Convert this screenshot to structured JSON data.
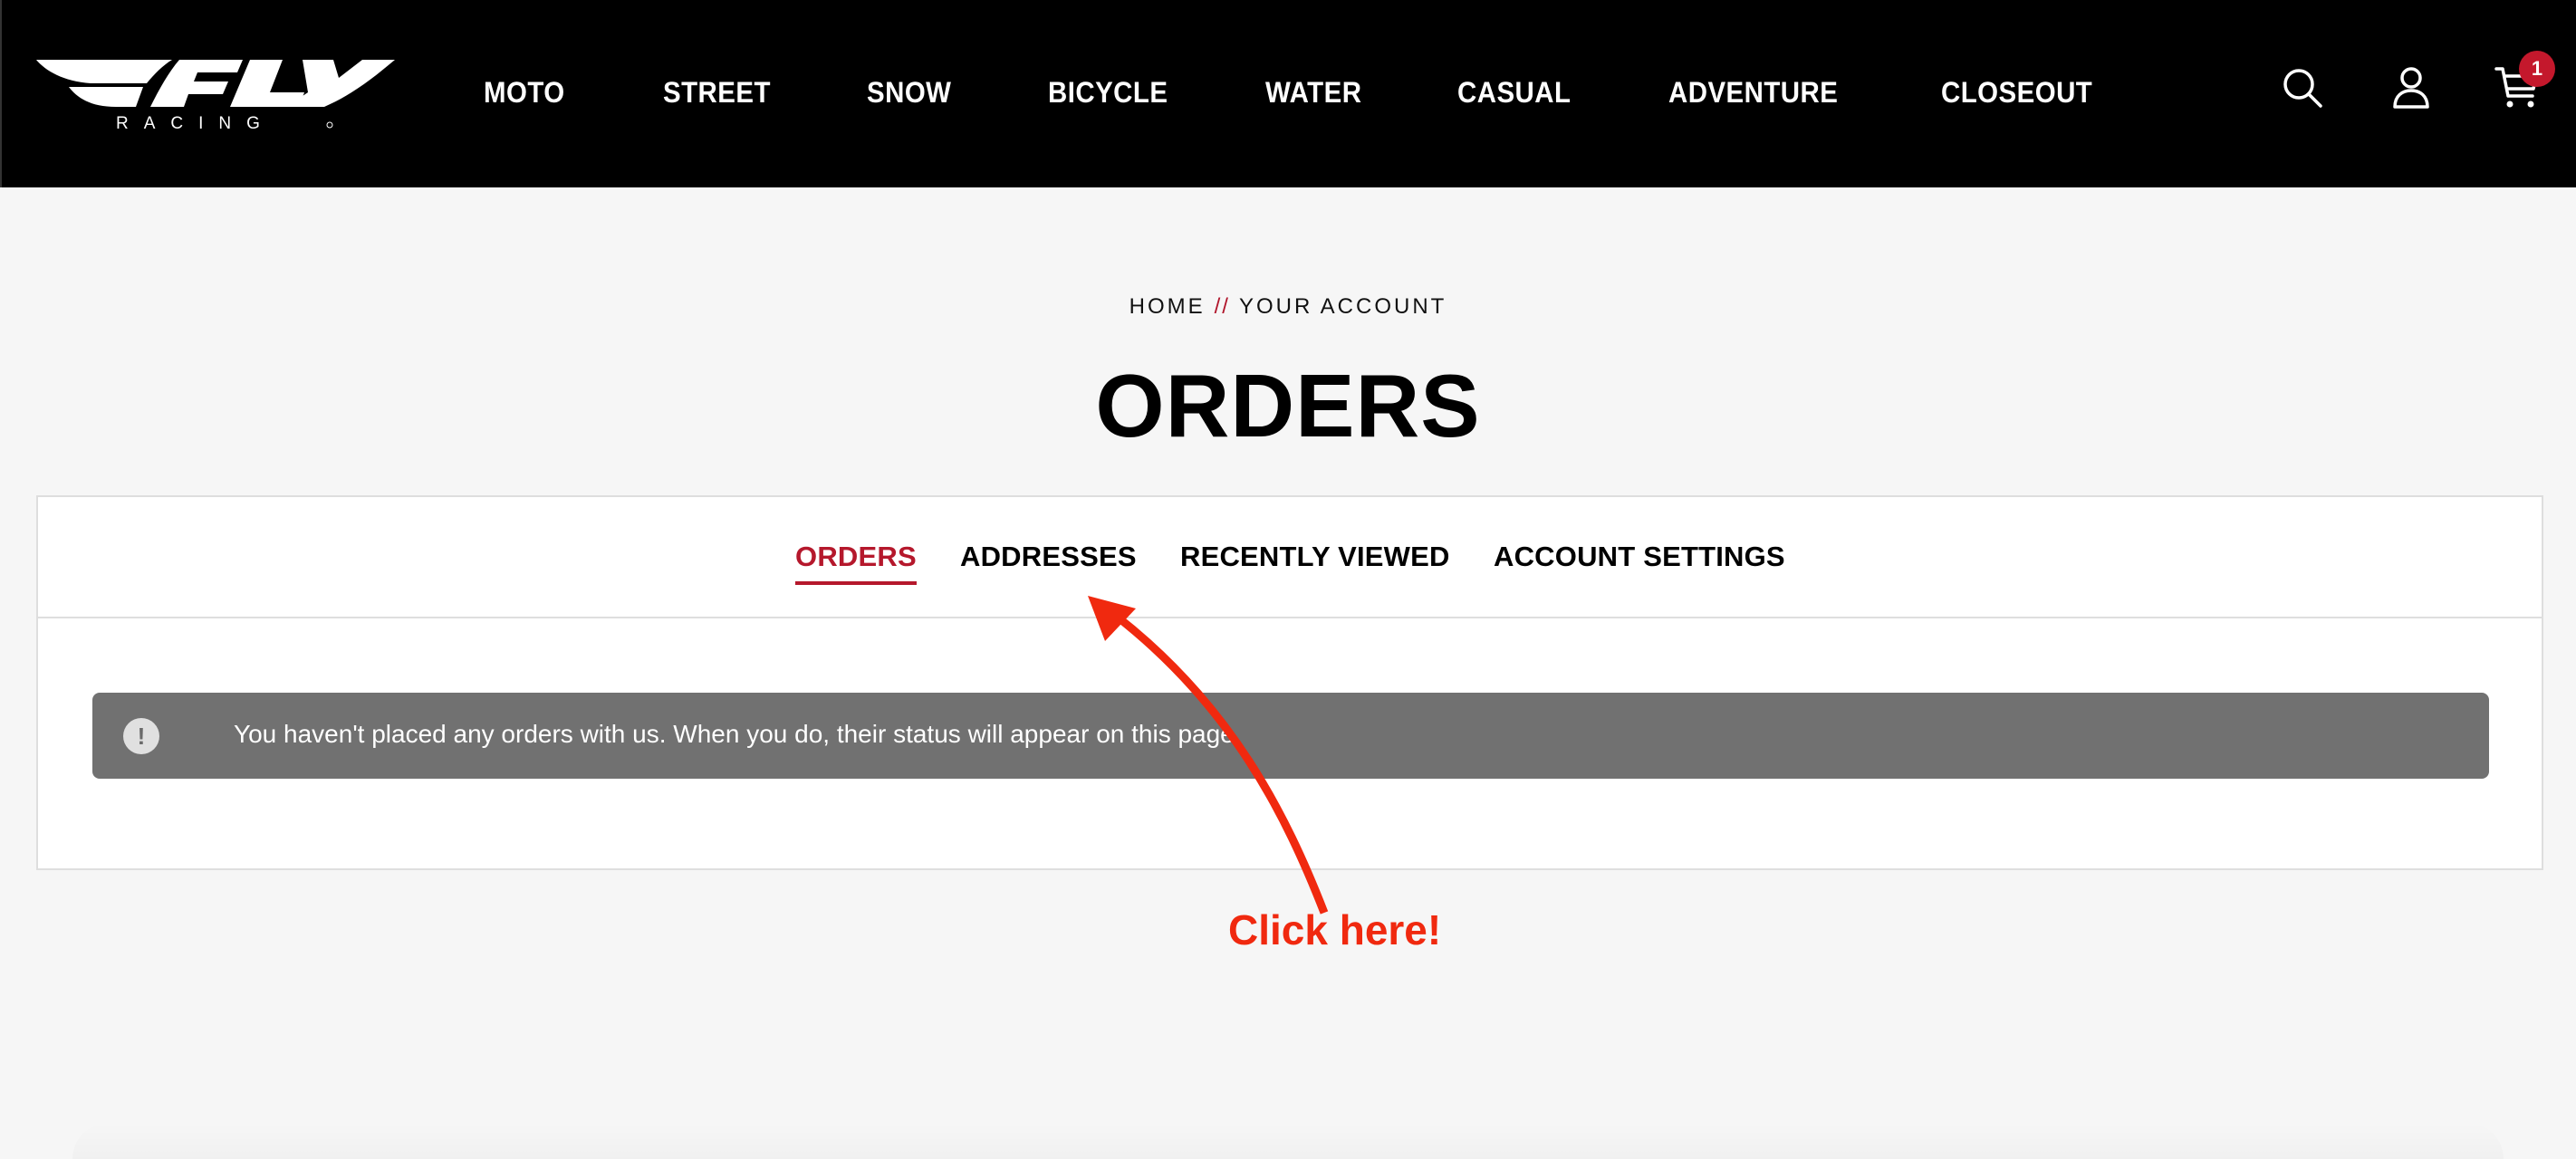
{
  "brand": {
    "logo_main": "FLY",
    "logo_sub": "RACING"
  },
  "header": {
    "nav": [
      {
        "label": "MOTO"
      },
      {
        "label": "STREET"
      },
      {
        "label": "SNOW"
      },
      {
        "label": "BICYCLE"
      },
      {
        "label": "WATER"
      },
      {
        "label": "CASUAL"
      },
      {
        "label": "ADVENTURE"
      },
      {
        "label": "CLOSEOUT"
      }
    ],
    "icons": {
      "search": "search-icon",
      "account": "user-icon",
      "cart": "cart-icon"
    },
    "cart_count": "1"
  },
  "breadcrumb": {
    "home": "HOME",
    "separator": "//",
    "current": "YOUR ACCOUNT"
  },
  "page_title": "ORDERS",
  "tabs": [
    {
      "label": "ORDERS",
      "active": true
    },
    {
      "label": "ADDRESSES",
      "active": false
    },
    {
      "label": "RECENTLY VIEWED",
      "active": false
    },
    {
      "label": "ACCOUNT SETTINGS",
      "active": false
    }
  ],
  "alert": {
    "icon": "!",
    "message": "You haven't placed any orders with us. When you do, their status will appear on this page."
  },
  "annotation": {
    "label": "Click here!"
  },
  "colors": {
    "header_bg": "#000000",
    "accent": "#b5182c",
    "badge": "#c4182c",
    "alert_bg": "#717171",
    "annotation": "#f0290f",
    "page_bg": "#f6f6f6"
  }
}
